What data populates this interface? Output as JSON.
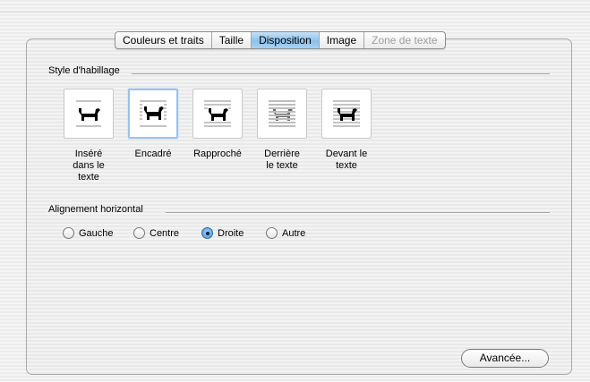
{
  "tabs": [
    {
      "label": "Couleurs et traits",
      "state": "normal"
    },
    {
      "label": "Taille",
      "state": "normal"
    },
    {
      "label": "Disposition",
      "state": "selected"
    },
    {
      "label": "Image",
      "state": "normal"
    },
    {
      "label": "Zone de texte",
      "state": "disabled"
    }
  ],
  "wrapping": {
    "title": "Style d'habillage",
    "options": [
      {
        "label": "Inséré\ndans le\ntexte",
        "icon": "inline-dog-icon"
      },
      {
        "label": "Encadré",
        "icon": "square-dog-icon",
        "selected": true
      },
      {
        "label": "Rapproché",
        "icon": "tight-dog-icon"
      },
      {
        "label": "Derrière\nle texte",
        "icon": "behind-text-dog-icon"
      },
      {
        "label": "Devant le\ntexte",
        "icon": "in-front-dog-icon"
      }
    ]
  },
  "alignment": {
    "title": "Alignement horizontal",
    "options": [
      {
        "label": "Gauche",
        "checked": false
      },
      {
        "label": "Centre",
        "checked": false
      },
      {
        "label": "Droite",
        "checked": true
      },
      {
        "label": "Autre",
        "checked": false
      }
    ]
  },
  "advanced_button": {
    "label": "Avancée..."
  },
  "colors": {
    "selected_tab": "#8cc1ec",
    "selected_border": "#9cc2ea",
    "radio_checked": "#3f8fd8"
  }
}
